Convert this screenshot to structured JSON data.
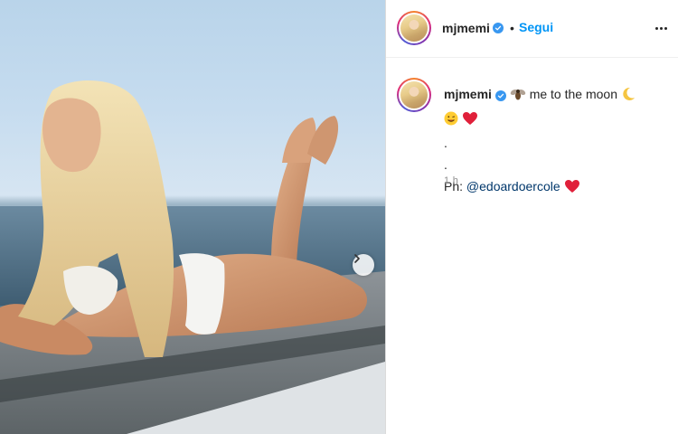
{
  "header": {
    "username": "mjmemi",
    "separator": "•",
    "follow_label": "Segui",
    "verified": true
  },
  "caption": {
    "username": "mjmemi",
    "text_main": "me to the moon",
    "emoji_fly": "fly-emoji",
    "emoji_moon": "moon-emoji",
    "emoji_smile": "smiling-face-emoji",
    "emoji_heart": "red-heart-emoji",
    "line_dot_1": ".",
    "line_dot_2": ".",
    "credit_prefix": "Ph: ",
    "credit_mention": "@edoardoercole",
    "emoji_heart_2": "red-heart-emoji"
  },
  "timestamp": "1 h",
  "colors": {
    "link_blue": "#0095f6",
    "verified_blue": "#3897f0",
    "mention": "#00376b",
    "muted": "#8e8e8e"
  },
  "icons": {
    "next": "chevron-right-icon",
    "more": "more-options-icon",
    "verified": "verified-badge-icon"
  }
}
